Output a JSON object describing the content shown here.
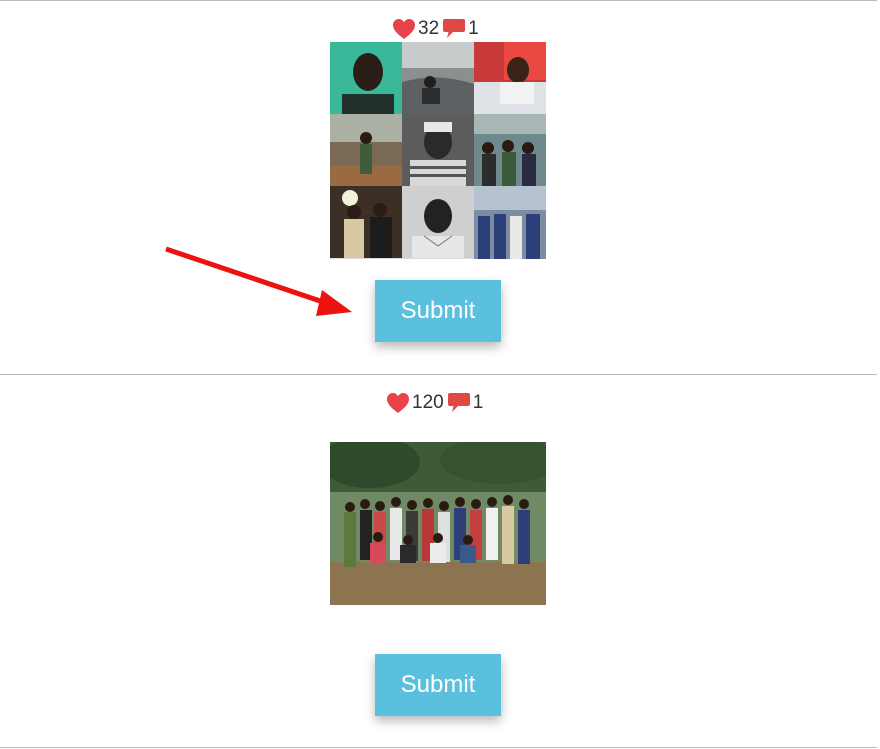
{
  "posts": [
    {
      "likes": "32",
      "comments": "1",
      "image_alt": "photo collage",
      "submit_label": "Submit"
    },
    {
      "likes": "120",
      "comments": "1",
      "image_alt": "group photo",
      "submit_label": "Submit"
    }
  ],
  "colors": {
    "heart": "#e8424a",
    "comment": "#e04848",
    "button": "#5bc0de",
    "arrow": "#ee1111",
    "divider": "#b9b9b9"
  },
  "icons": {
    "like": "heart-icon",
    "comment": "comment-bubble-icon",
    "annotation": "red-arrow-icon"
  }
}
